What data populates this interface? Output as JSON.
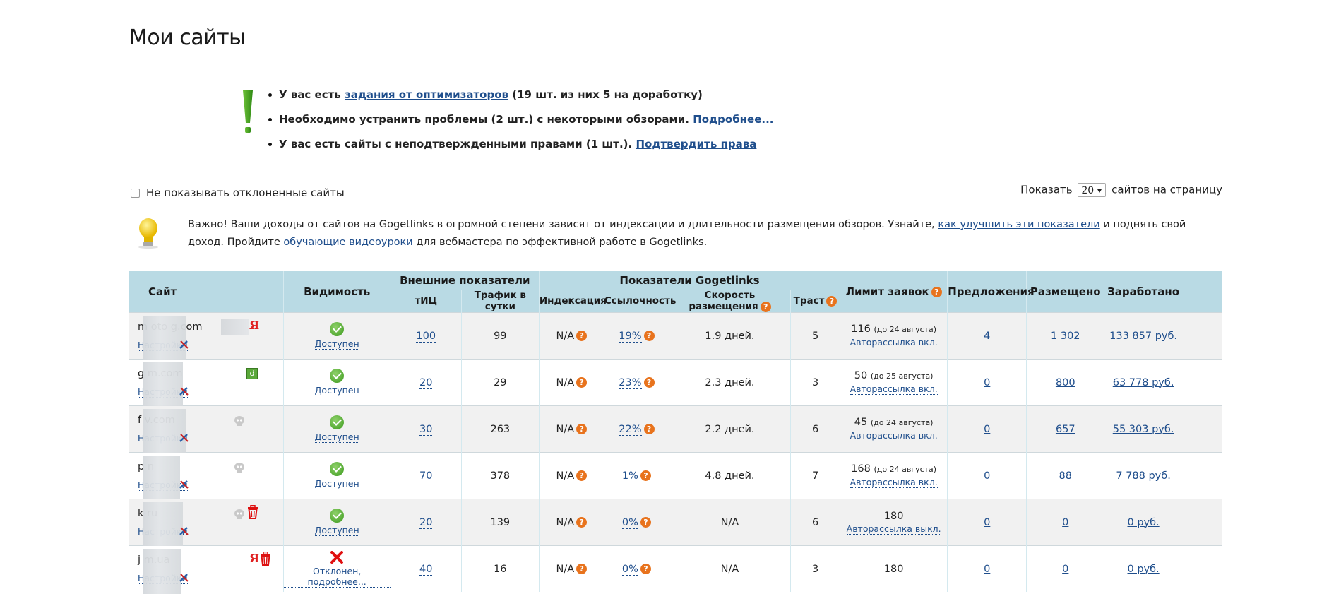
{
  "page_title": "Мои сайты",
  "notices": [
    {
      "prefix": "У вас есть ",
      "link": "задания от оптимизаторов",
      "suffix": " (19 шт. из них 5 на доработку)"
    },
    {
      "prefix": "Необходимо устранить проблемы (2 шт.) с некоторыми обзорами. ",
      "link": "Подробнее...",
      "suffix": ""
    },
    {
      "prefix": "У вас есть сайты с неподтвержденными правами (1 шт.). ",
      "link": "Подтвердить права",
      "suffix": ""
    }
  ],
  "options": {
    "hide_rejected_label": "Не показывать отклоненные сайты",
    "show_label": "Показать",
    "per_page_value": "20",
    "per_page_suffix": "сайтов на страницу"
  },
  "tip": {
    "t1": "Важно! Ваши доходы от сайтов на Gogetlinks в огромной степени зависят от индексации и длительности размещения обзоров. Узнайте, ",
    "l1": "как улучшить эти показатели",
    "t2": " и поднять свой доход. Пройдите ",
    "l2": "обучающие видеоуроки",
    "t3": " для вебмастера по эффективной работе в Gogetlinks."
  },
  "table": {
    "headers": {
      "site": "Сайт",
      "visibility": "Видимость",
      "external": "Внешние показатели",
      "tic": "тИЦ",
      "traffic": "Трафик в сутки",
      "ggl": "Показатели Gogetlinks",
      "indexing": "Индексация",
      "linkness": "Ссылочность",
      "speed": "Скорость размещения",
      "trust": "Траст",
      "limit": "Лимит заявок",
      "offers": "Предложения",
      "placed": "Размещено",
      "earned": "Заработано"
    },
    "rows": [
      {
        "site": "m      oto      g.com",
        "settings": "Настройки",
        "badges": [
          "ya"
        ],
        "visibility": "Доступен",
        "visible": true,
        "tic": "100",
        "traffic": "99",
        "indexing": "N/A",
        "linkness": "19%",
        "speed": "1.9 дней.",
        "speed_color": "green",
        "trust": "5",
        "trust_color": "yellow",
        "limit": "116",
        "limit_date": "(до 24 августа)",
        "autosend": "Авторассылка вкл.",
        "offers": "4",
        "placed": "1 302",
        "earned": "133 857 руб."
      },
      {
        "site": "g           m.com",
        "settings": "Настройки",
        "badges": [
          "dz"
        ],
        "visibility": "Доступен",
        "visible": true,
        "tic": "20",
        "traffic": "29",
        "indexing": "N/A",
        "linkness": "23%",
        "speed": "2.3 дней.",
        "speed_color": "green",
        "trust": "3",
        "trust_color": "yellow",
        "limit": "50",
        "limit_date": "(до 25 августа)",
        "autosend": "Авторассылка вкл.",
        "offers": "0",
        "placed": "800",
        "earned": "63 778 руб."
      },
      {
        "site": "f           v.com",
        "settings": "Настройки",
        "badges": [
          "skull"
        ],
        "visibility": "Доступен",
        "visible": true,
        "tic": "30",
        "traffic": "263",
        "indexing": "N/A",
        "linkness": "22%",
        "speed": "2.2 дней.",
        "speed_color": "green",
        "trust": "6",
        "trust_color": "green",
        "limit": "45",
        "limit_date": "(до 24 августа)",
        "autosend": "Авторассылка вкл.",
        "offers": "0",
        "placed": "657",
        "earned": "55 303 руб."
      },
      {
        "site": "p          n",
        "settings": "Настройки",
        "badges": [
          "skull"
        ],
        "visibility": "Доступен",
        "visible": true,
        "tic": "70",
        "traffic": "378",
        "indexing": "N/A",
        "linkness": "1%",
        "speed": "4.8 дней.",
        "speed_color": "orange",
        "trust": "7",
        "trust_color": "green",
        "limit": "168",
        "limit_date": "(до 24 августа)",
        "autosend": "Авторассылка вкл.",
        "offers": "0",
        "placed": "88",
        "earned": "7 788 руб."
      },
      {
        "site": "k          ru",
        "settings": "Настройки",
        "badges": [
          "skull",
          "trash"
        ],
        "visibility": "Доступен",
        "visible": true,
        "tic": "20",
        "traffic": "139",
        "indexing": "N/A",
        "linkness": "0%",
        "speed": "N/A",
        "speed_color": "none",
        "trust": "6",
        "trust_color": "green",
        "limit": "180",
        "limit_date": "",
        "autosend": "Авторассылка выкл.",
        "offers": "0",
        "placed": "0",
        "earned": "0 руб."
      },
      {
        "site": "j          m.ua",
        "settings": "Настройки",
        "badges": [
          "ya",
          "trash"
        ],
        "visibility": "Отклонен, подробнее...",
        "visible": false,
        "tic": "40",
        "traffic": "16",
        "indexing": "N/A",
        "linkness": "0%",
        "speed": "N/A",
        "speed_color": "none",
        "trust": "3",
        "trust_color": "yellow",
        "limit": "180",
        "limit_date": "",
        "autosend": "",
        "offers": "0",
        "placed": "0",
        "earned": "0 руб."
      }
    ]
  },
  "colors": {
    "header_bg": "#b9dae4",
    "link": "#1f4e8c",
    "green": "#3a8a1c",
    "orange": "#e07020",
    "help": "#e8731d"
  }
}
